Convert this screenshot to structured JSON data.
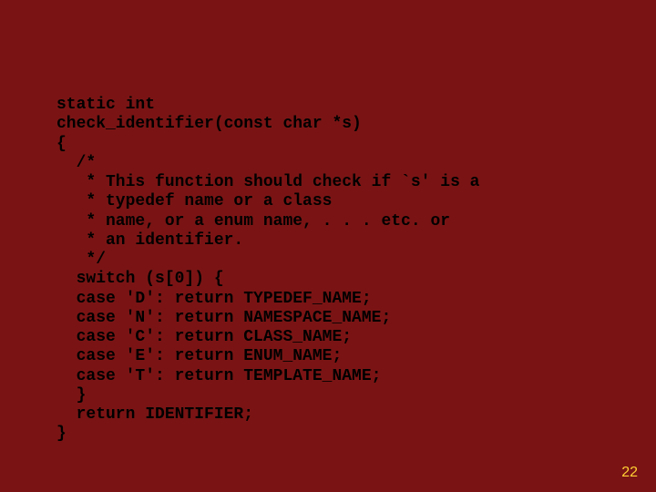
{
  "code": {
    "l01": "static int",
    "l02": "check_identifier(const char *s)",
    "l03": "{",
    "l04": "  /*",
    "l05": "   * This function should check if `s' is a",
    "l06": "   * typedef name or a class",
    "l07": "   * name, or a enum name, . . . etc. or",
    "l08": "   * an identifier.",
    "l09": "   */",
    "l10": "  switch (s[0]) {",
    "l11": "  case 'D': return TYPEDEF_NAME;",
    "l12": "  case 'N': return NAMESPACE_NAME;",
    "l13": "  case 'C': return CLASS_NAME;",
    "l14": "  case 'E': return ENUM_NAME;",
    "l15": "  case 'T': return TEMPLATE_NAME;",
    "l16": "  }",
    "l17": "  return IDENTIFIER;",
    "l18": "}"
  },
  "page_number": "22"
}
